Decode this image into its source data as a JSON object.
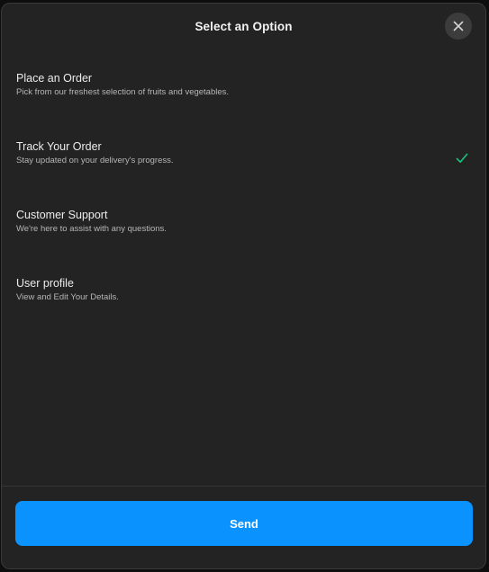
{
  "dialog": {
    "title": "Select an Option",
    "close_icon": "close-icon",
    "selected_index": 1,
    "accent_color": "#0a93ff",
    "check_color": "#19c37d"
  },
  "options": [
    {
      "title": "Place an Order",
      "description": "Pick from our freshest selection of fruits and vegetables.",
      "selected": false
    },
    {
      "title": "Track Your Order",
      "description": "Stay updated on your delivery's progress.",
      "selected": true,
      "icon": "check-icon"
    },
    {
      "title": "Customer Support",
      "description": "We're here to assist with any questions.",
      "selected": false
    },
    {
      "title": "User profile",
      "description": "View and Edit Your Details.",
      "selected": false
    }
  ],
  "footer": {
    "send_label": "Send"
  }
}
